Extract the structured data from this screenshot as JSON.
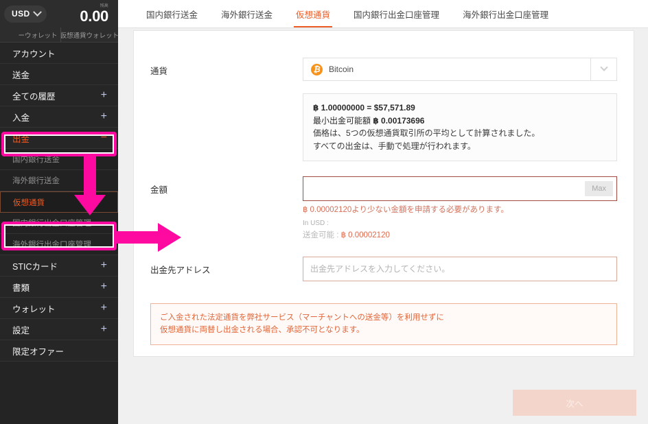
{
  "sidebar": {
    "currency_selector": {
      "label": "USD",
      "icon": "chevron-down-icon"
    },
    "balance": {
      "caption": "残高",
      "amount": "0.00"
    },
    "wallet_tabs": [
      {
        "label": "ーウォレット"
      },
      {
        "label": "仮想通貨ウォレット"
      }
    ],
    "nav": [
      {
        "label": "アカウント",
        "expander": "",
        "level": "main",
        "state": "normal"
      },
      {
        "label": "送金",
        "expander": "",
        "level": "main",
        "state": "normal"
      },
      {
        "label": "全ての履歴",
        "expander": "+",
        "level": "main",
        "state": "normal"
      },
      {
        "label": "入金",
        "expander": "+",
        "level": "main",
        "state": "normal"
      },
      {
        "label": "出金",
        "expander": "−",
        "level": "main",
        "state": "active"
      },
      {
        "label": "国内銀行送金",
        "expander": "",
        "level": "sub",
        "state": "normal"
      },
      {
        "label": "海外銀行送金",
        "expander": "",
        "level": "sub",
        "state": "normal"
      },
      {
        "label": "仮想通貨",
        "expander": "",
        "level": "sub",
        "state": "selected"
      },
      {
        "label": "国内銀行出金口座管理",
        "expander": "",
        "level": "sub",
        "state": "normal"
      },
      {
        "label": "海外銀行出金口座管理",
        "expander": "",
        "level": "sub",
        "state": "normal"
      },
      {
        "label": "STICカード",
        "expander": "+",
        "level": "main",
        "state": "normal"
      },
      {
        "label": "書類",
        "expander": "+",
        "level": "main",
        "state": "normal"
      },
      {
        "label": "ウォレット",
        "expander": "+",
        "level": "main",
        "state": "normal"
      },
      {
        "label": "設定",
        "expander": "+",
        "level": "main",
        "state": "normal"
      },
      {
        "label": "限定オファー",
        "expander": "",
        "level": "main",
        "state": "normal"
      }
    ]
  },
  "tabs": [
    {
      "label": "国内銀行送金",
      "active": false
    },
    {
      "label": "海外銀行送金",
      "active": false
    },
    {
      "label": "仮想通貨",
      "active": true
    },
    {
      "label": "国内銀行出金口座管理",
      "active": false
    },
    {
      "label": "海外銀行出金口座管理",
      "active": false
    }
  ],
  "form": {
    "currency": {
      "label": "通貨",
      "selected": "Bitcoin",
      "icon": "bitcoin-icon",
      "icon_glyph": "₿",
      "chevron": "chevron-down-icon"
    },
    "rate_info": {
      "line1": "฿ 1.00000000 = $57,571.89",
      "line2_label": "最小出金可能額",
      "line2_value": "฿ 0.00173696",
      "line3": "価格は、5つの仮想通貨取引所の平均として計算されました。",
      "line4": "すべての出金は、手動で処理が行われます。"
    },
    "amount": {
      "label": "金額",
      "value": "",
      "placeholder": "",
      "max_button": "Max",
      "error": "฿ 0.00002120より少ない金額を申請する必要があります。",
      "in_usd_label": "In USD :",
      "available_label": "送金可能 :",
      "available_value": "฿ 0.00002120"
    },
    "address": {
      "label": "出金先アドレス",
      "value": "",
      "placeholder": "出金先アドレスを入力してください。"
    },
    "warning": {
      "line1": "ご入金された法定通貨を弊社サービス（マーチャントへの送金等）を利用せずに",
      "line2": "仮想通貨に両替し出金される場合、承認不可となります。"
    },
    "submit": {
      "label": "次へ",
      "disabled": true
    }
  },
  "annotations": {
    "color": "#ff0aa0",
    "highlight_withdraw": "出金",
    "highlight_crypto": "仮想通貨"
  },
  "colors": {
    "accent_orange": "#ec5c24",
    "bitcoin_orange": "#f7931a",
    "annotation_magenta": "#ff0aa0",
    "sidebar_bg": "#242424"
  }
}
